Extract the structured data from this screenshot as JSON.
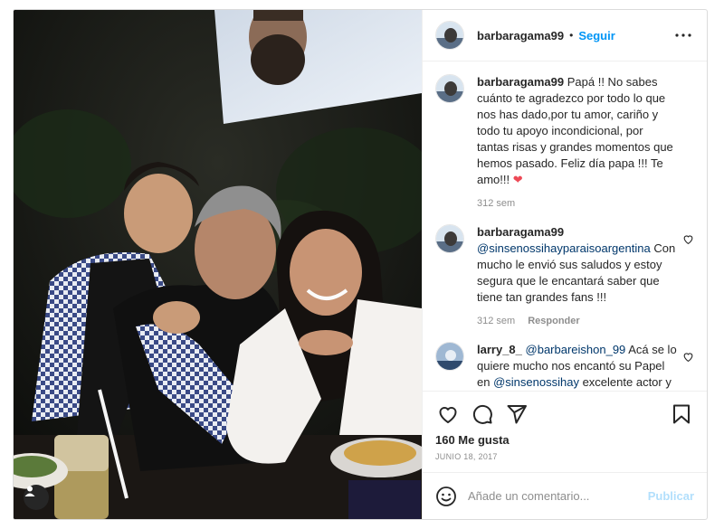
{
  "post": {
    "author": "barbaragama99",
    "follow_label": "Seguir",
    "separator": "•",
    "more_icon": "more-horizontal-icon"
  },
  "caption": {
    "username": "barbaragama99",
    "text": "Papá !! No sabes cuánto te agradezco por todo lo que nos has dado,por tu amor, cariño y todo tu apoyo incondicional, por tantas risas y grandes momentos que hemos pasado. Feliz día papa !!! Te amo!!!",
    "emoji": "❤",
    "time": "312 sem"
  },
  "comments": [
    {
      "username": "barbaragama99",
      "mention": "@sinsenossihayparaisoargentina",
      "text": "Con mucho le envió sus saludos y estoy segura que le encantará saber que tiene tan grandes fans !!!",
      "time": "312 sem",
      "reply_label": "Responder"
    },
    {
      "username": "larry_8_",
      "mention": "@barbareishon_99",
      "text_before": "Acá se lo quiere mucho nos encantó su Papel en",
      "mention2": "@sinsenossihay",
      "text_after": "excelente actor y además de un Papel y Sinsenossihay"
    }
  ],
  "actions": {
    "likes": "160 Me gusta",
    "date": "JUNIO 18, 2017"
  },
  "add_comment": {
    "placeholder": "Añade un comentario...",
    "publish_label": "Publicar"
  },
  "colors": {
    "accent": "#0095f6",
    "text": "#262626",
    "muted": "#8e8e8e",
    "heart": "#ed4956",
    "link": "#00376b"
  }
}
